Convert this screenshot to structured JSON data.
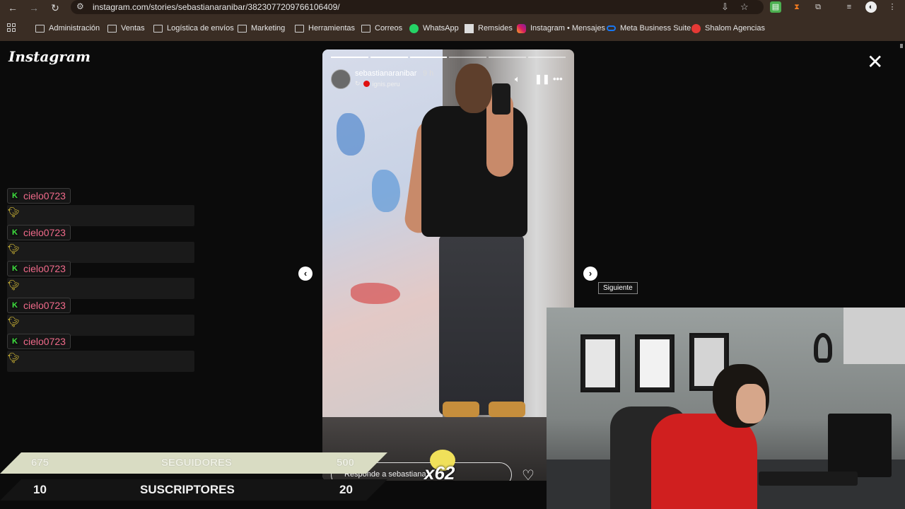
{
  "browser": {
    "url": "instagram.com/stories/sebastianaranibar/3823077209766106409/",
    "bookmarks": [
      {
        "label": "Administración",
        "icon": "folder-icon"
      },
      {
        "label": "Ventas",
        "icon": "folder-icon"
      },
      {
        "label": "Logística de envíos",
        "icon": "folder-icon"
      },
      {
        "label": "Marketing",
        "icon": "folder-icon"
      },
      {
        "label": "Herramientas",
        "icon": "folder-icon"
      },
      {
        "label": "Correos",
        "icon": "folder-icon"
      },
      {
        "label": "WhatsApp",
        "icon": "whatsapp-icon"
      },
      {
        "label": "Remsides",
        "icon": "site-icon"
      },
      {
        "label": "Instagram • Mensajes",
        "icon": "instagram-icon"
      },
      {
        "label": "Meta Business Suite",
        "icon": "meta-icon"
      },
      {
        "label": "Shalom Agencias",
        "icon": "shalom-icon"
      }
    ]
  },
  "instagram": {
    "logo": "Instagram",
    "close_icon": "close-icon",
    "story": {
      "username": "sebastianaranibar",
      "time": "9 h",
      "reposted_from": "ignis.peru",
      "reply_placeholder": "Responde a sebastiana",
      "progress_segments_total": 6,
      "progress_segments_done": 3
    },
    "tooltip_next": "Siguiente"
  },
  "chat": [
    {
      "user": "cielo0723",
      "badge": "K"
    },
    {
      "user": "cielo0723",
      "badge": "K"
    },
    {
      "user": "cielo0723",
      "badge": "K"
    },
    {
      "user": "cielo0723",
      "badge": "K"
    },
    {
      "user": "cielo0723",
      "badge": "K"
    }
  ],
  "stats": {
    "followers": {
      "current": "675",
      "label": "SEGUIDORES",
      "goal": "500"
    },
    "subscribers": {
      "current": "10",
      "label": "SUSCRIPTORES",
      "goal": "20"
    },
    "multiplier": "x62"
  },
  "colors": {
    "chat_username": "#f06a8a",
    "badge_green": "#3fe33f",
    "stats_bar_light": "#d9dcc3"
  }
}
